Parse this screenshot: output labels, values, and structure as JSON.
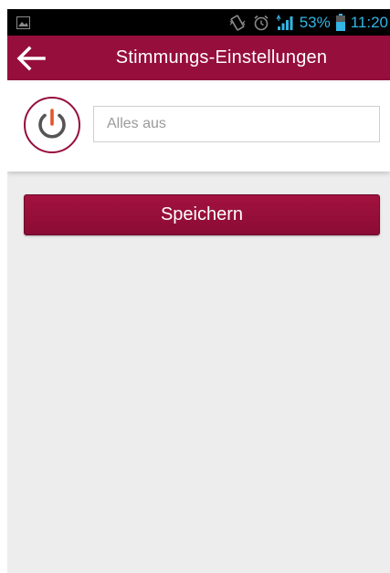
{
  "status_bar": {
    "battery_percent": "53%",
    "time": "11:20",
    "icons": [
      "gallery-notification-icon",
      "vibrate-icon",
      "alarm-icon",
      "signal-icon",
      "battery-icon"
    ]
  },
  "app_bar": {
    "title": "Stimmungs-Einstellungen",
    "back_icon": "arrow-left-icon"
  },
  "mood": {
    "icon": "power-icon",
    "name_value": "",
    "name_placeholder": "Alles aus"
  },
  "actions": {
    "save_label": "Speichern"
  },
  "colors": {
    "primary": "#960e3b",
    "status_text": "#33b5e5",
    "power_accent": "#e2572a",
    "background": "#ededed"
  }
}
